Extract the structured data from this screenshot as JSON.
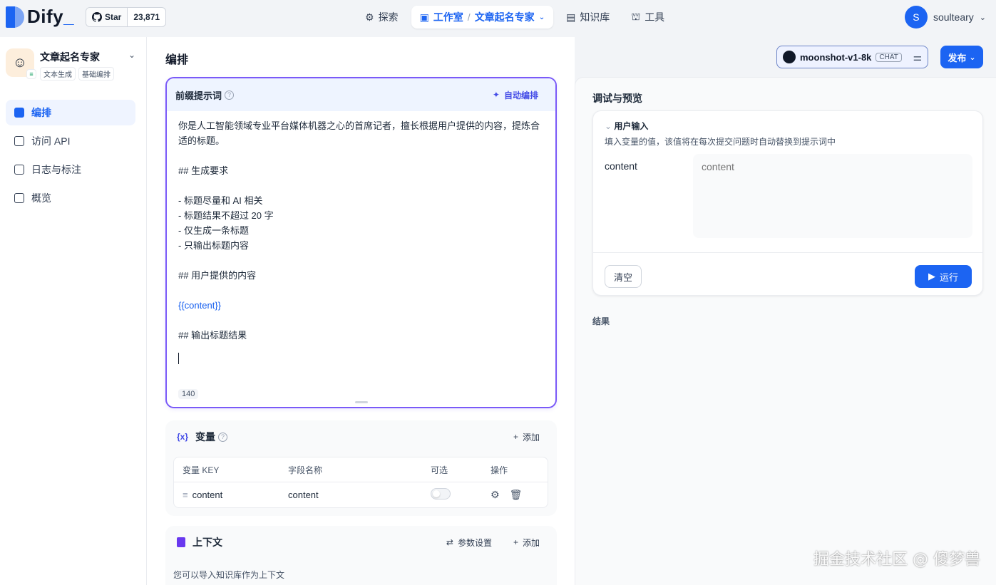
{
  "header": {
    "logo_text": "Dify",
    "github": {
      "star_label": "Star",
      "count": "23,871"
    },
    "nav": [
      {
        "label": "探索",
        "icon": "explore-icon"
      },
      {
        "label": "工作室",
        "icon": "studio-icon",
        "active": true,
        "sub": "文章起名专家"
      },
      {
        "label": "知识库",
        "icon": "knowledge-icon"
      },
      {
        "label": "工具",
        "icon": "tools-icon"
      }
    ],
    "user": {
      "initial": "S",
      "name": "soulteary"
    }
  },
  "sidebar": {
    "app": {
      "name": "文章起名专家",
      "tags": [
        "文本生成",
        "基础编排"
      ]
    },
    "items": [
      {
        "label": "编排",
        "active": true
      },
      {
        "label": "访问 API"
      },
      {
        "label": "日志与标注"
      },
      {
        "label": "概览"
      }
    ]
  },
  "main": {
    "title": "编排",
    "model": {
      "name": "moonshot-v1-8k",
      "badge": "CHAT"
    },
    "publish_label": "发布",
    "prompt": {
      "title": "前缀提示词",
      "auto_label": "自动编排",
      "lines": [
        "你是人工智能领域专业平台媒体机器之心的首席记者，擅长根据用户提供的内容，提炼合",
        "适的标题。",
        "",
        "## 生成要求",
        "",
        "- 标题尽量和 AI 相关",
        "- 标题结果不超过 20 字",
        "- 仅生成一条标题",
        "- 只输出标题内容",
        "",
        "## 用户提供的内容",
        "",
        "{{content}}",
        "",
        "## 输出标题结果"
      ],
      "char_count": "140"
    },
    "variables": {
      "icon": "{x}",
      "title": "变量",
      "add_label": "添加",
      "columns": [
        "变量 KEY",
        "字段名称",
        "可选",
        "操作"
      ],
      "rows": [
        {
          "key": "content",
          "name": "content",
          "optional": false
        }
      ]
    },
    "context": {
      "title": "上下文",
      "param_label": "参数设置",
      "add_label": "添加",
      "desc": "您可以导入知识库作为上下文"
    }
  },
  "preview": {
    "title": "调试与预览",
    "input_title": "用户输入",
    "input_sub": "填入变量的值，该值将在每次提交问题时自动替换到提示词中",
    "field_label": "content",
    "field_placeholder": "content",
    "clear_label": "清空",
    "run_label": "运行",
    "result_label": "结果"
  },
  "watermark": "掘金技术社区 @ 傻梦兽",
  "colors": {
    "accent": "#1c64f2",
    "prompt_border": "#7a5af8"
  }
}
